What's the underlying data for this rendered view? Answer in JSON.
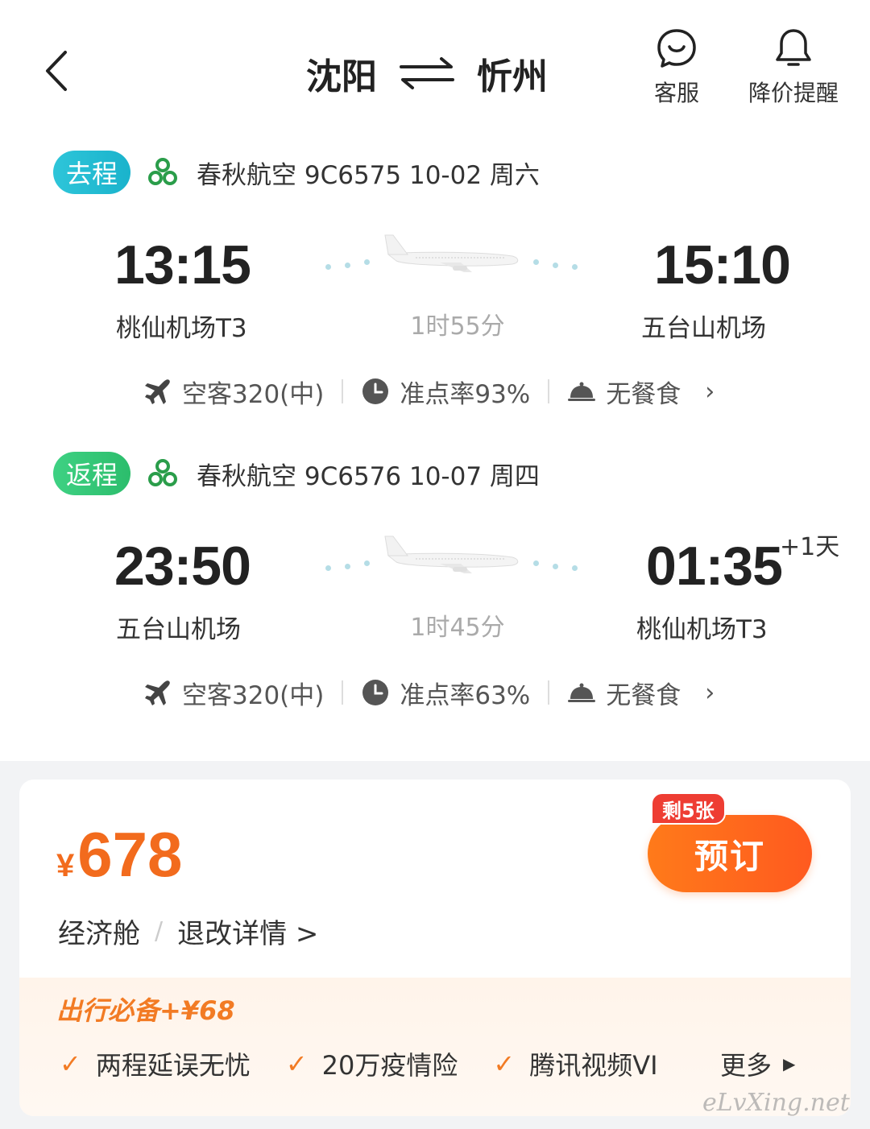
{
  "header": {
    "from_city": "沈阳",
    "to_city": "忻州",
    "service_label": "客服",
    "price_alert_label": "降价提醒"
  },
  "outbound": {
    "tag": "去程",
    "info": "春秋航空 9C6575  10-02 周六",
    "dep_time": "13:15",
    "arr_time": "15:10",
    "dep_airport": "桃仙机场T3",
    "arr_airport": "五台山机场",
    "duration": "1时55分",
    "aircraft": "空客320(中)",
    "ontime": "准点率93%",
    "meal": "无餐食"
  },
  "return": {
    "tag": "返程",
    "info": "春秋航空 9C6576  10-07 周四",
    "dep_time": "23:50",
    "arr_time": "01:35",
    "plus_day": "+1天",
    "dep_airport": "五台山机场",
    "arr_airport": "桃仙机场T3",
    "duration": "1时45分",
    "aircraft": "空客320(中)",
    "ontime": "准点率63%",
    "meal": "无餐食"
  },
  "booking": {
    "currency": "¥",
    "price": "678",
    "cabin": "经济舱",
    "separator": "/",
    "rules": "退改详情 >",
    "remaining": "剩5张",
    "book_label": "预订"
  },
  "addon": {
    "title": "出行必备+¥68",
    "items": [
      "两程延误无忧",
      "20万疫情险",
      "腾讯视频VI"
    ],
    "more_label": "更多"
  },
  "watermark": "eLvXing.net",
  "colors": {
    "accent_orange": "#f26b1d",
    "go_tag": "#1ab3cc",
    "back_tag": "#2cbd6c",
    "badge_red": "#ee3d33"
  }
}
